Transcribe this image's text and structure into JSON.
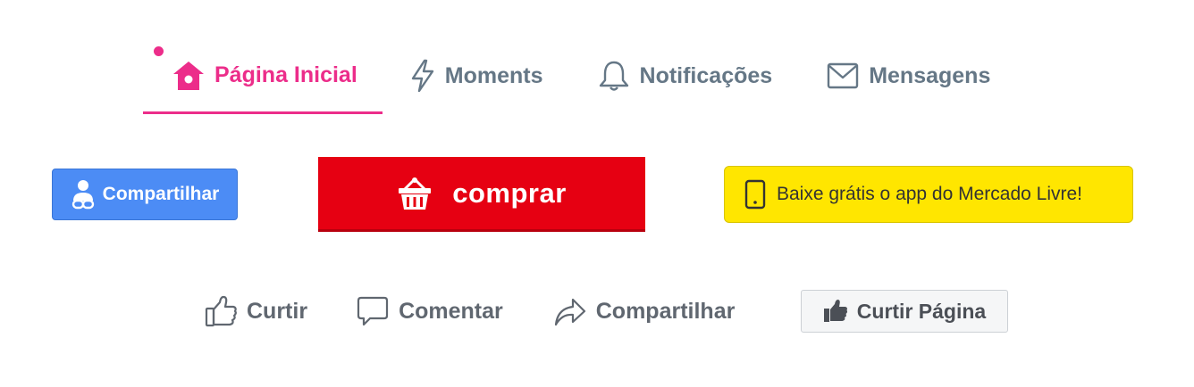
{
  "nav": {
    "tabs": [
      {
        "label": "Página Inicial",
        "icon": "home-icon",
        "active": true
      },
      {
        "label": "Moments",
        "icon": "lightning-icon",
        "active": false
      },
      {
        "label": "Notificações",
        "icon": "bell-icon",
        "active": false
      },
      {
        "label": "Mensagens",
        "icon": "envelope-icon",
        "active": false
      }
    ]
  },
  "buttons": {
    "share_blue": {
      "label": "Compartilhar",
      "icon": "user-link-icon",
      "color": "#4c8cf5"
    },
    "comprar": {
      "label": "comprar",
      "icon": "basket-icon",
      "color": "#e60012"
    },
    "mercado_livre": {
      "label": "Baixe grátis o app do Mercado Livre!",
      "icon": "phone-icon",
      "color": "#ffe600"
    }
  },
  "social": {
    "actions": [
      {
        "label": "Curtir",
        "icon": "thumbs-up-outline-icon"
      },
      {
        "label": "Comentar",
        "icon": "speech-bubble-icon"
      },
      {
        "label": "Compartilhar",
        "icon": "share-arrow-icon"
      }
    ],
    "like_page": {
      "label": "Curtir Página",
      "icon": "thumbs-up-filled-icon"
    }
  },
  "colors": {
    "active_tab": "#ec2d8a",
    "inactive_tab": "#657786",
    "social_text": "#606770"
  }
}
